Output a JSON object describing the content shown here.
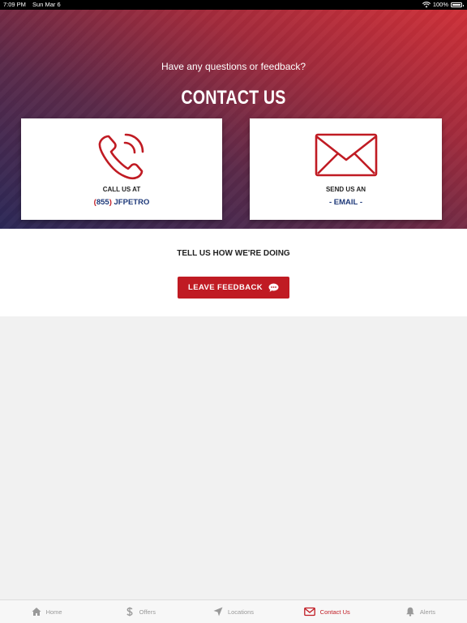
{
  "status_bar": {
    "time": "7:09 PM",
    "date": "Sun Mar 6",
    "battery": "100%"
  },
  "hero": {
    "question": "Have any questions or feedback?",
    "title": "CONTACT US"
  },
  "phone_card": {
    "label": "CALL US AT",
    "area_open": "(",
    "area_code": "855",
    "area_close": ")",
    "number": "JFPETRO",
    "icon": "phone-ringing-icon"
  },
  "email_card": {
    "label": "SEND US AN",
    "value": "- EMAIL -",
    "icon": "envelope-icon"
  },
  "feedback": {
    "title": "TELL US HOW WE'RE DOING",
    "button_label": "LEAVE FEEDBACK",
    "button_icon": "chat-bubble-icon"
  },
  "tabs": [
    {
      "label": "Home",
      "icon": "home-icon",
      "active": false
    },
    {
      "label": "Offers",
      "icon": "dollar-icon",
      "active": false
    },
    {
      "label": "Locations",
      "icon": "location-arrow-icon",
      "active": false
    },
    {
      "label": "Contact Us",
      "icon": "envelope-icon",
      "active": true
    },
    {
      "label": "Alerts",
      "icon": "bell-icon",
      "active": false
    }
  ],
  "colors": {
    "accent": "#c01b23",
    "link_blue": "#1f3a7a",
    "tab_inactive": "#999999",
    "gradient_start": "#2b2857",
    "gradient_end": "#cf3038"
  }
}
